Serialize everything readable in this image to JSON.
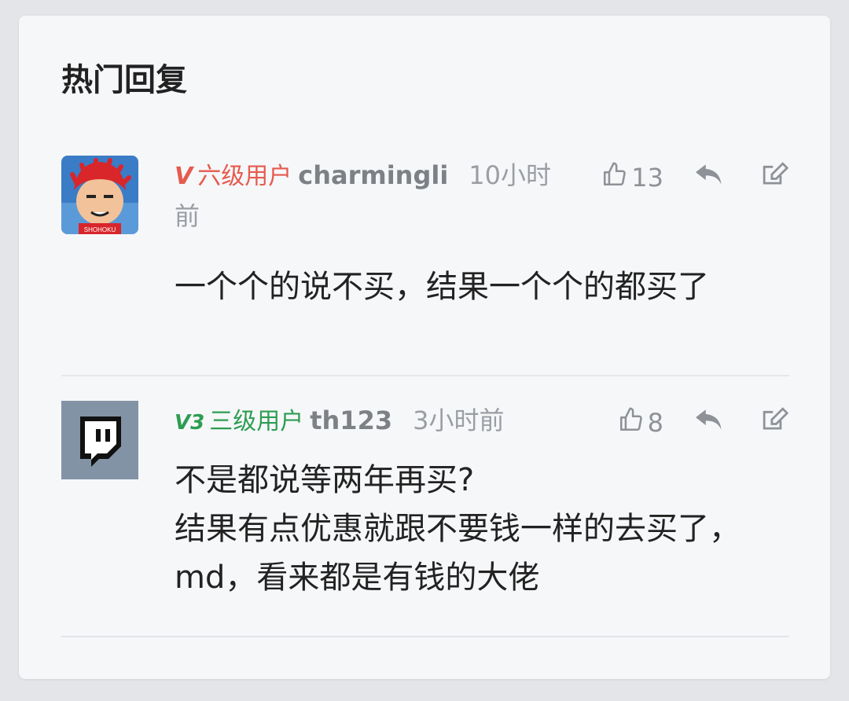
{
  "section": {
    "title": "热门回复"
  },
  "replies": [
    {
      "level_icon": "V",
      "level_label": "六级用户",
      "level_color": "#e55b4f",
      "username": "charmingli",
      "time": "10小时前",
      "likes": "13",
      "content": "一个个的说不买，结果一个个的都买了",
      "avatar": "slam-dunk-avatar"
    },
    {
      "level_icon": "V3",
      "level_label": "三级用户",
      "level_color": "#2e9d52",
      "username": "th123",
      "time": "3小时前",
      "likes": "8",
      "content": "不是都说等两年再买?\n结果有点优惠就跟不要钱一样的去买了，md，看来都是有钱的大佬",
      "avatar": "twitch-logo-avatar"
    }
  ],
  "icons": {
    "like": "thumbs-up-icon",
    "reply": "reply-arrow-icon",
    "edit": "edit-icon"
  }
}
